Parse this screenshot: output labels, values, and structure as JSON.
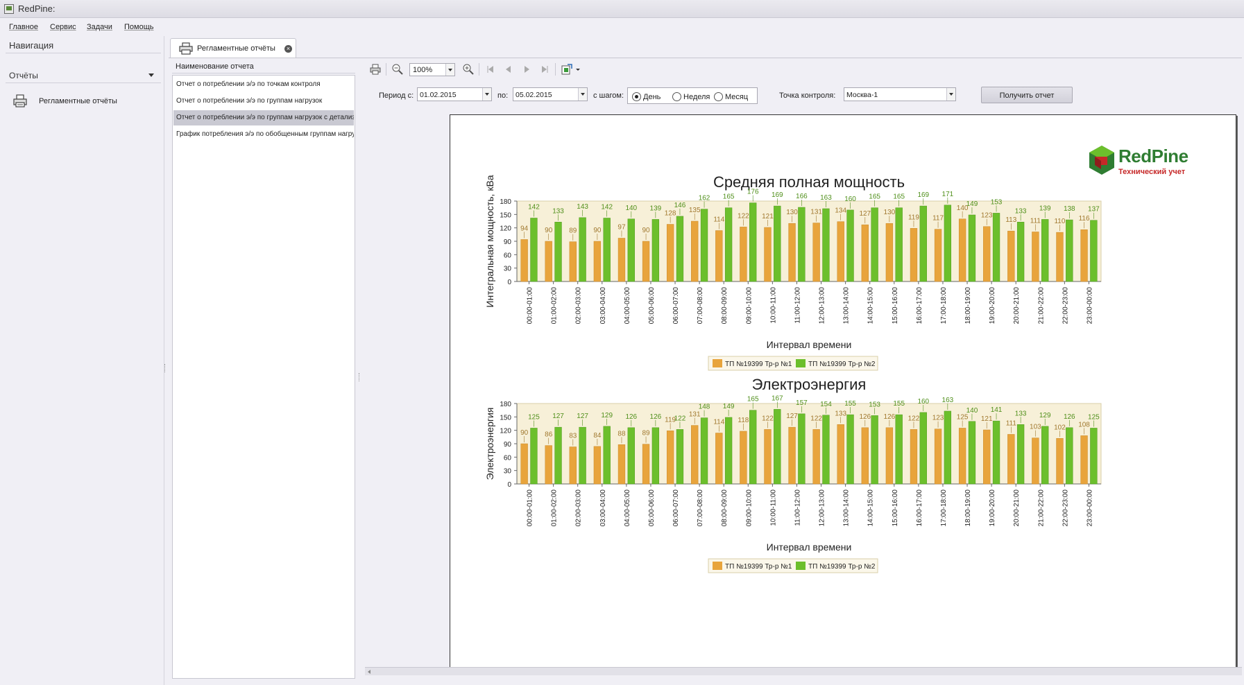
{
  "app": {
    "title": "RedPine:"
  },
  "menu": [
    "Главное",
    "Сервис",
    "Задачи",
    "Помощь"
  ],
  "navigation": {
    "title": "Навигация",
    "group": "Отчёты",
    "items": [
      {
        "label": "Регламентные отчёты",
        "icon": "printer-icon"
      }
    ]
  },
  "tab": {
    "label": "Регламентные отчёты"
  },
  "report_list": {
    "header": "Наименование отчета",
    "items": [
      "Отчет о потреблении э/э по точкам контроля",
      "Отчет о потреблении э/э по группам нагрузок",
      "Отчет о потреблении э/э по группам нагрузок с детализацией",
      "График потребления э/э по обобщенным группам нагрузок"
    ],
    "selected_index": 2
  },
  "toolbar": {
    "zoom": "100%",
    "icons": [
      "print-icon",
      "zoom-out-icon",
      "zoom-in-icon",
      "first-page-icon",
      "prev-page-icon",
      "next-page-icon",
      "last-page-icon",
      "export-icon"
    ]
  },
  "params": {
    "period_from_label": "Период с:",
    "period_from": "01.02.2015",
    "period_to_label": "по:",
    "period_to": "05.02.2015",
    "step_label": "с шагом:",
    "step_options": [
      "День",
      "Неделя",
      "Месяц"
    ],
    "step_selected": 0,
    "control_point_label": "Точка контроля:",
    "control_point": "Москва-1",
    "get_report_button": "Получить отчет"
  },
  "report": {
    "logo_name": "RedPine",
    "logo_sub": "Технический учет"
  },
  "colors": {
    "series1": "#e8a43c",
    "series2": "#6cbf2c",
    "label1": "#a0782e",
    "label2": "#4f8f1a",
    "plot_bg": "#f7f0d8"
  },
  "chart_data": [
    {
      "type": "bar",
      "title": "Средняя полная мощность",
      "xlabel": "Интервал времени",
      "ylabel": "Интегральная мощность, кВа",
      "ylim": [
        0,
        180
      ],
      "yticks": [
        0,
        30,
        60,
        90,
        120,
        150,
        180
      ],
      "grid": false,
      "legend": "bottom-center",
      "categories": [
        "00:00-01:00",
        "01:00-02:00",
        "02:00-03:00",
        "03:00-04:00",
        "04:00-05:00",
        "05:00-06:00",
        "06:00-07:00",
        "07:00-08:00",
        "08:00-09:00",
        "09:00-10:00",
        "10:00-11:00",
        "11:00-12:00",
        "12:00-13:00",
        "13:00-14:00",
        "14:00-15:00",
        "15:00-16:00",
        "16:00-17:00",
        "17:00-18:00",
        "18:00-19:00",
        "19:00-20:00",
        "20:00-21:00",
        "21:00-22:00",
        "22:00-23:00",
        "23:00-00:00"
      ],
      "series": [
        {
          "name": "ТП №19399 Тр-р №1",
          "values": [
            94,
            90,
            89,
            90,
            97,
            90,
            128,
            135,
            114,
            122,
            121,
            130,
            131,
            134,
            127,
            130,
            119,
            117,
            140,
            123,
            113,
            111,
            110,
            116
          ]
        },
        {
          "name": "ТП №19399 Тр-р №2",
          "values": [
            142,
            133,
            143,
            142,
            140,
            139,
            146,
            162,
            165,
            176,
            169,
            166,
            163,
            160,
            165,
            165,
            169,
            171,
            149,
            153,
            133,
            139,
            138,
            137
          ]
        }
      ]
    },
    {
      "type": "bar",
      "title": "Электроэнергия",
      "xlabel": "Интервал времени",
      "ylabel": "Электроэнергия",
      "ylim": [
        0,
        180
      ],
      "yticks": [
        0,
        30,
        60,
        90,
        120,
        150,
        180
      ],
      "grid": false,
      "legend": "bottom-center",
      "categories": [
        "00:00-01:00",
        "01:00-02:00",
        "02:00-03:00",
        "03:00-04:00",
        "04:00-05:00",
        "05:00-06:00",
        "06:00-07:00",
        "07:00-08:00",
        "08:00-09:00",
        "09:00-10:00",
        "10:00-11:00",
        "11:00-12:00",
        "12:00-13:00",
        "13:00-14:00",
        "14:00-15:00",
        "15:00-16:00",
        "16:00-17:00",
        "17:00-18:00",
        "18:00-19:00",
        "19:00-20:00",
        "20:00-21:00",
        "21:00-22:00",
        "22:00-23:00",
        "23:00-00:00"
      ],
      "series": [
        {
          "name": "ТП №19399 Тр-р №1",
          "values": [
            90,
            86,
            83,
            84,
            88,
            89,
            119,
            131,
            114,
            118,
            122,
            127,
            122,
            133,
            126,
            126,
            122,
            123,
            125,
            121,
            111,
            103,
            102,
            108
          ]
        },
        {
          "name": "ТП №19399 Тр-р №2",
          "values": [
            125,
            127,
            127,
            129,
            126,
            126,
            122,
            148,
            149,
            165,
            167,
            157,
            154,
            155,
            153,
            155,
            160,
            163,
            140,
            141,
            133,
            129,
            126,
            125
          ]
        }
      ]
    }
  ]
}
